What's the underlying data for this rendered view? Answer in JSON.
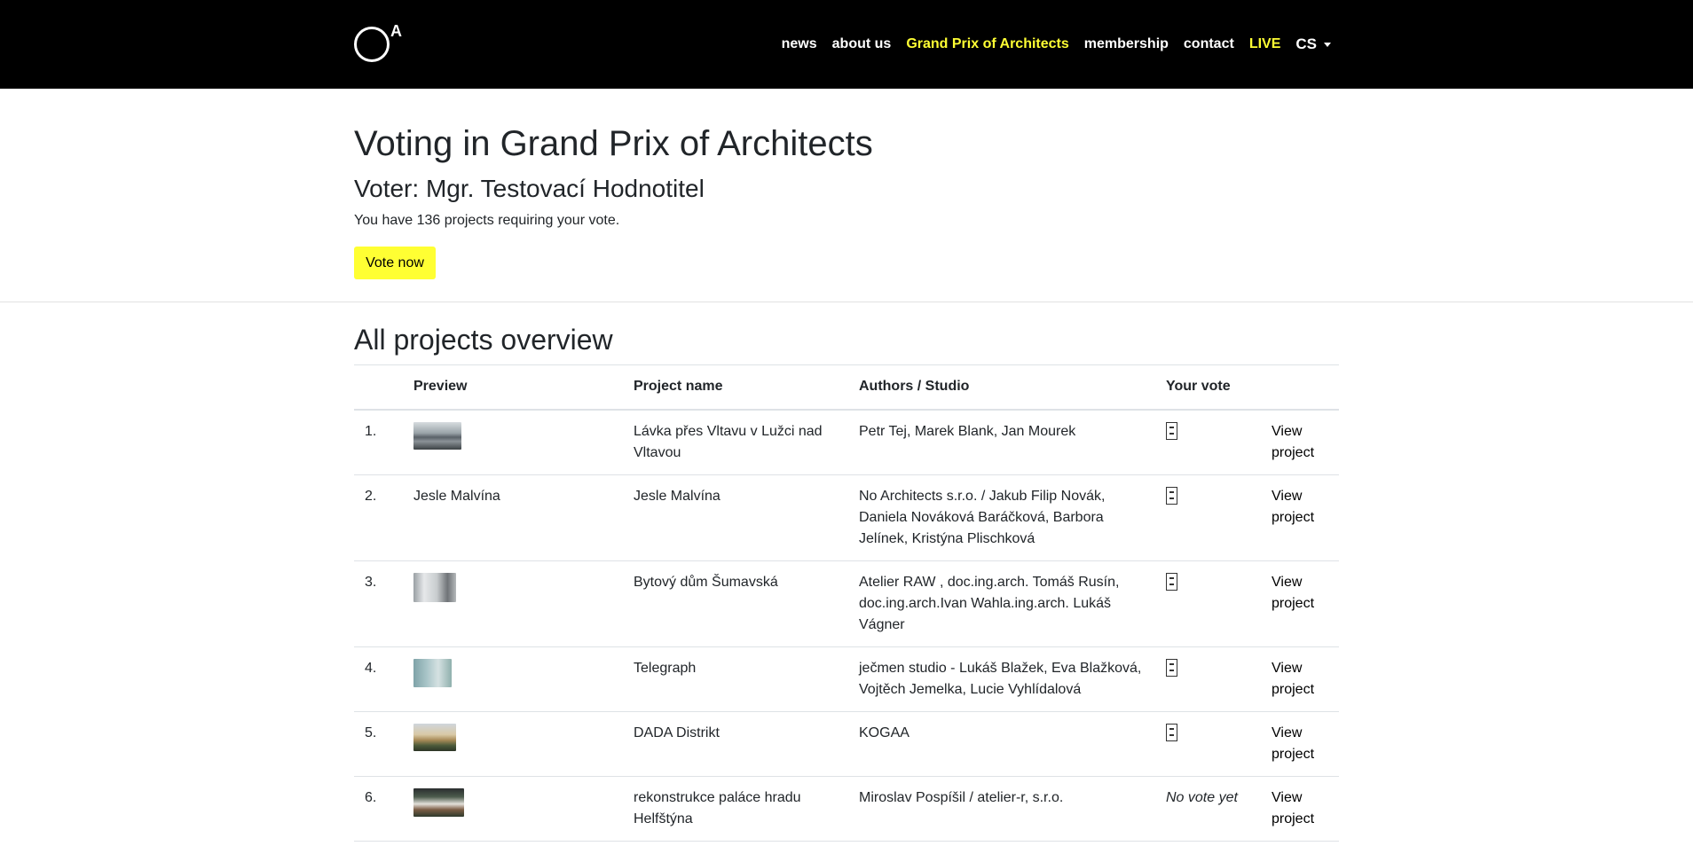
{
  "nav": {
    "logo_letter": "A",
    "items": [
      {
        "label": "news"
      },
      {
        "label": "about us"
      },
      {
        "label": "Grand Prix of Architects"
      },
      {
        "label": "membership"
      },
      {
        "label": "contact"
      },
      {
        "label": "LIVE"
      }
    ],
    "language": "CS",
    "accent_color": "#ffff33"
  },
  "main": {
    "title": "Voting in Grand Prix of Architects",
    "voter": "Voter: Mgr. Testovací Hodnotitel",
    "requiring": "You have 136 projects requiring your vote.",
    "vote_button": "Vote now"
  },
  "overview": {
    "title": "All projects overview",
    "columns": [
      "",
      "Preview",
      "Project name",
      "Authors / Studio",
      "Your vote",
      ""
    ],
    "rows": [
      {
        "num": "1.",
        "preview_text": "",
        "name": "Lávka přes Vltavu v Lužci nad Vltavou",
        "authors": "Petr Tej, Marek Blank, Jan Mourek",
        "vote": "",
        "link": "View project"
      },
      {
        "num": "2.",
        "preview_text": "Jesle Malvína",
        "name": "Jesle Malvína",
        "authors": "No Architects s.r.o. / Jakub Filip Novák, Daniela Nováková Baráčková, Barbora Jelínek, Kristýna Plischková",
        "vote": "",
        "link": "View project"
      },
      {
        "num": "3.",
        "preview_text": "",
        "name": "Bytový dům Šumavská",
        "authors": "Atelier RAW , doc.ing.arch. Tomáš Rusín, doc.ing.arch.Ivan Wahla.ing.arch. Lukáš Vágner",
        "vote": "",
        "link": "View project"
      },
      {
        "num": "4.",
        "preview_text": "",
        "name": "Telegraph",
        "authors": "ječmen studio - Lukáš Blažek, Eva Blažková, Vojtěch Jemelka, Lucie Vyhlídalová",
        "vote": "",
        "link": "View project"
      },
      {
        "num": "5.",
        "preview_text": "",
        "name": "DADA Distrikt",
        "authors": "KOGAA",
        "vote": "",
        "link": "View project"
      },
      {
        "num": "6.",
        "preview_text": "",
        "name": "rekonstrukce paláce hradu Helfštýna",
        "authors": "Miroslav Pospíšil / atelier-r, s.r.o.",
        "vote": "No vote yet",
        "link": "View project"
      }
    ]
  }
}
